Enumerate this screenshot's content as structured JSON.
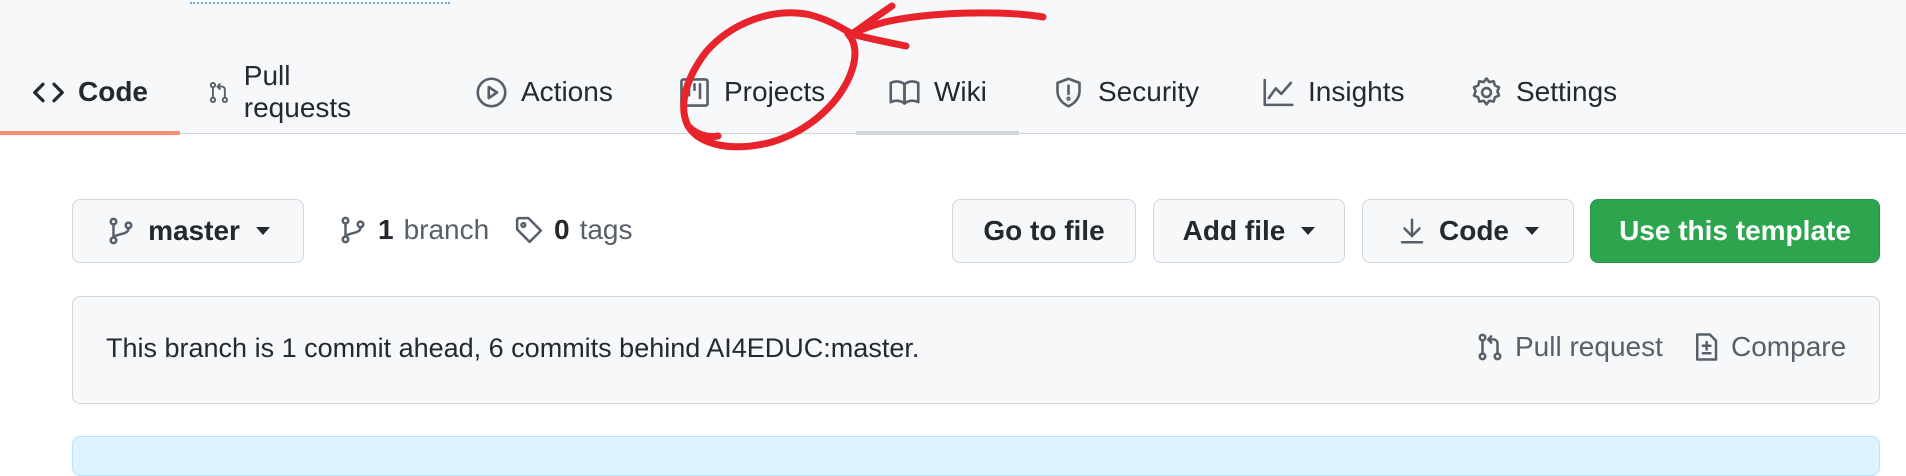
{
  "repo_nav": {
    "tabs": [
      {
        "label": "Code",
        "icon": "code-icon",
        "selected": true
      },
      {
        "label": "Pull requests",
        "icon": "git-pull-request-icon"
      },
      {
        "label": "Actions",
        "icon": "play-icon"
      },
      {
        "label": "Projects",
        "icon": "table-icon"
      },
      {
        "label": "Wiki",
        "icon": "book-icon"
      },
      {
        "label": "Security",
        "icon": "shield-icon"
      },
      {
        "label": "Insights",
        "icon": "graph-icon"
      },
      {
        "label": "Settings",
        "icon": "gear-icon"
      }
    ]
  },
  "toolbar": {
    "branch_selector": "master",
    "branch_count": "1",
    "branch_label": "branch",
    "tag_count": "0",
    "tag_label": "tags",
    "go_to_file": "Go to file",
    "add_file": "Add file",
    "code": "Code",
    "use_template": "Use this template"
  },
  "notice": {
    "text": "This branch is 1 commit ahead, 6 commits behind AI4EDUC:master.",
    "pull_request": "Pull request",
    "compare": "Compare"
  },
  "colors": {
    "selected_tab_underline": "#fd8c73",
    "primary_button": "#2da44e",
    "annotation_ink": "#e8232b"
  }
}
